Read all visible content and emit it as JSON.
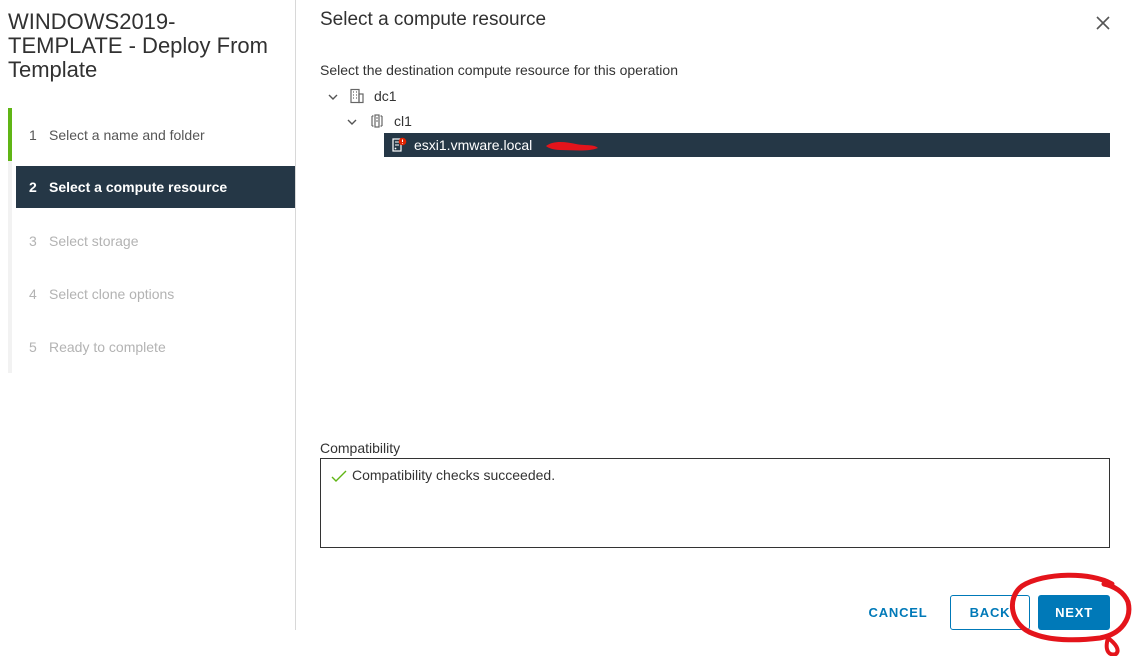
{
  "wizard": {
    "title": "WINDOWS2019-TEMPLATE - Deploy From Template",
    "steps": [
      {
        "num": "1",
        "label": "Select a name and folder",
        "state": "done"
      },
      {
        "num": "2",
        "label": "Select a compute resource",
        "state": "current"
      },
      {
        "num": "3",
        "label": "Select storage",
        "state": "pending"
      },
      {
        "num": "4",
        "label": "Select clone options",
        "state": "pending"
      },
      {
        "num": "5",
        "label": "Ready to complete",
        "state": "pending"
      }
    ]
  },
  "page": {
    "title": "Select a compute resource",
    "instruction": "Select the destination compute resource for this operation"
  },
  "tree": {
    "datacenter": "dc1",
    "cluster": "cl1",
    "host": "esxi1.vmware.local"
  },
  "compatibility": {
    "label": "Compatibility",
    "message": "Compatibility checks succeeded."
  },
  "footer": {
    "cancel": "CANCEL",
    "back": "BACK",
    "next": "NEXT"
  },
  "colors": {
    "accent": "#0079b8",
    "selected_bg": "#253746",
    "done_green": "#60b515",
    "annotation_red": "#e4141b"
  },
  "icons": {
    "close": "close-icon",
    "datacenter": "datacenter-icon",
    "cluster": "cluster-icon",
    "host": "host-warning-icon",
    "check": "check-icon"
  }
}
